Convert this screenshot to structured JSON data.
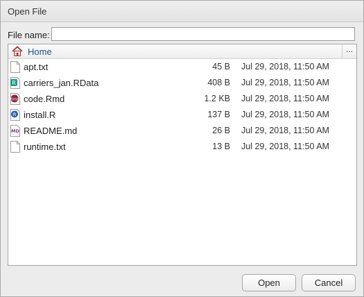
{
  "dialog": {
    "title": "Open File",
    "filename_label": "File name:",
    "filename_value": "",
    "path": {
      "label": "Home",
      "icon": "home-icon"
    },
    "more_label": "...",
    "files": [
      {
        "name": "apt.txt",
        "size": "45 B",
        "modified": "Jul 29, 2018, 11:50 AM",
        "icon": "text-file-icon"
      },
      {
        "name": "carriers_jan.RData",
        "size": "408 B",
        "modified": "Jul 29, 2018, 11:50 AM",
        "icon": "rdata-file-icon"
      },
      {
        "name": "code.Rmd",
        "size": "1.2 KB",
        "modified": "Jul 29, 2018, 11:50 AM",
        "icon": "rmd-file-icon"
      },
      {
        "name": "install.R",
        "size": "137 B",
        "modified": "Jul 29, 2018, 11:50 AM",
        "icon": "r-script-icon"
      },
      {
        "name": "README.md",
        "size": "26 B",
        "modified": "Jul 29, 2018, 11:50 AM",
        "icon": "markdown-file-icon"
      },
      {
        "name": "runtime.txt",
        "size": "13 B",
        "modified": "Jul 29, 2018, 11:50 AM",
        "icon": "text-file-icon"
      }
    ],
    "buttons": {
      "open": "Open",
      "cancel": "Cancel"
    }
  },
  "colors": {
    "path_link": "#1f4e8c",
    "rdata_icon": "#1a9c8a",
    "rmd_icon": "#8b2942",
    "r_script_icon": "#2a64b4",
    "markdown_icon": "#7a3d98"
  }
}
